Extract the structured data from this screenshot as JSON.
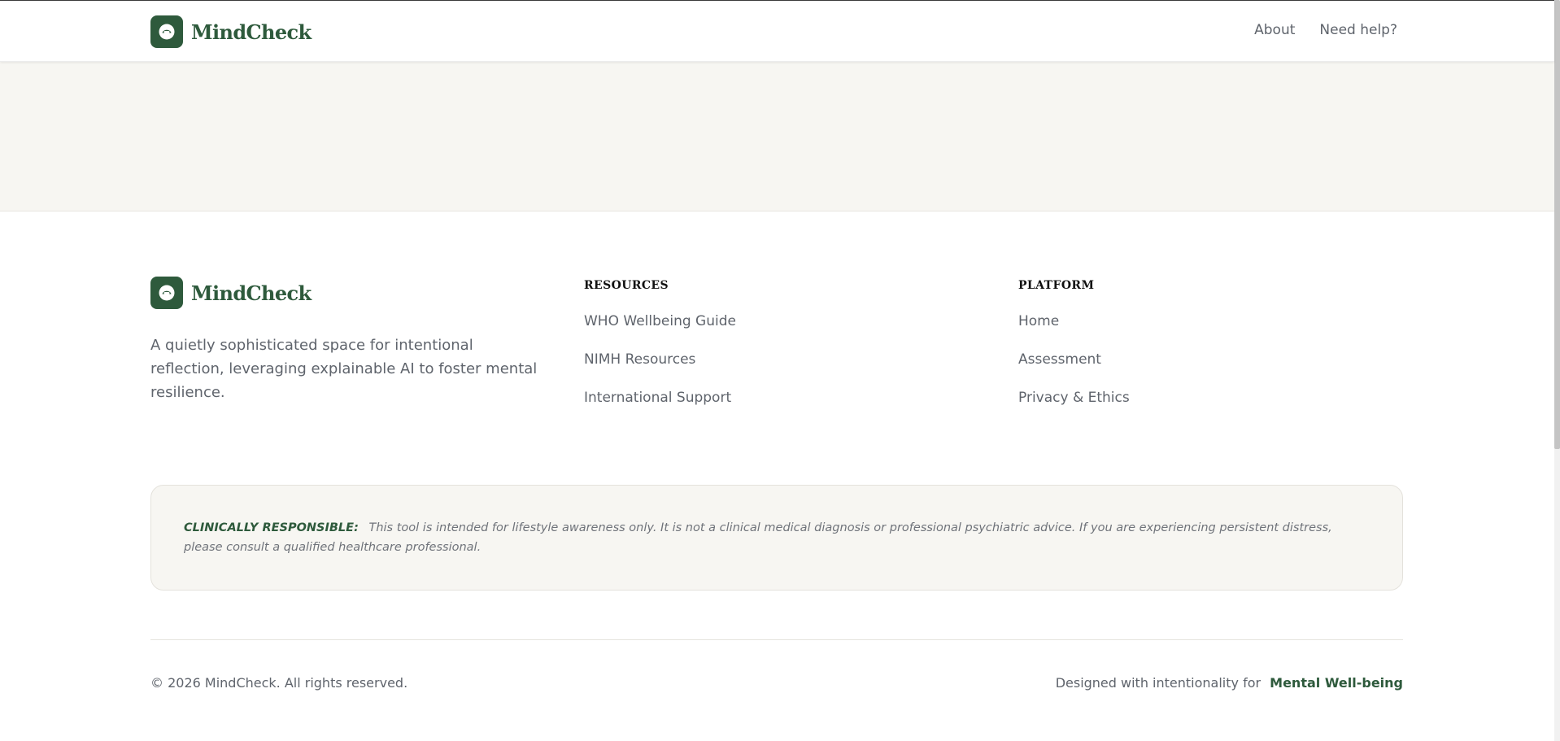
{
  "header": {
    "brand_name": "MindCheck",
    "logo_icon": "head-icon",
    "nav": [
      {
        "label": "About"
      },
      {
        "label": "Need help?"
      }
    ]
  },
  "footer": {
    "brand_name": "MindCheck",
    "tagline": "A quietly sophisticated space for intentional reflection, leveraging explainable AI to foster mental resilience.",
    "columns": [
      {
        "title": "RESOURCES",
        "links": [
          "WHO Wellbeing Guide",
          "NIMH Resources",
          "International Support"
        ]
      },
      {
        "title": "PLATFORM",
        "links": [
          "Home",
          "Assessment",
          "Privacy & Ethics"
        ]
      }
    ],
    "disclaimer": {
      "label": "CLINICALLY RESPONSIBLE:",
      "text": "This tool is intended for lifestyle awareness only. It is not a clinical medical diagnosis or professional psychiatric advice. If you are experiencing persistent distress, please consult a qualified healthcare professional."
    },
    "copyright": "© 2026 MindCheck. All rights reserved.",
    "credit_prefix": "Designed with intentionality for",
    "credit_link": "Mental Well-being"
  },
  "colors": {
    "brand": "#2e5a3c",
    "surface": "#f7f6f2",
    "text": "#5f646c"
  }
}
